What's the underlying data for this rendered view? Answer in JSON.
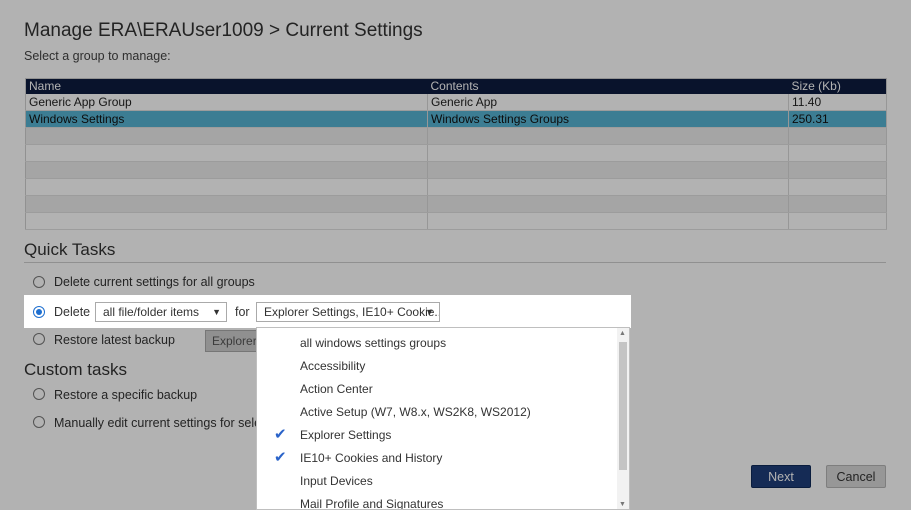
{
  "header": {
    "title": "Manage ERA\\ERAUser1009 > Current Settings",
    "subtitle": "Select a group to manage:"
  },
  "table": {
    "columns": [
      "Name",
      "Contents",
      "Size (Kb)"
    ],
    "rows": [
      {
        "name": "Generic App Group",
        "contents": "Generic App",
        "size": "11.40"
      },
      {
        "name": "Windows Settings",
        "contents": "Windows Settings Groups",
        "size": "250.31"
      }
    ]
  },
  "quick_tasks": {
    "heading": "Quick Tasks",
    "delete_all_label": "Delete current settings for all groups",
    "delete_label": "Delete",
    "items_select": "all file/folder items",
    "for_label": "for",
    "groups_select": "Explorer Settings, IE10+ Cookie...",
    "restore_latest_label": "Restore latest backup",
    "restore_select": "Explorer S"
  },
  "custom_tasks": {
    "heading": "Custom tasks",
    "restore_specific_label": "Restore a specific backup",
    "manual_edit_label": "Manually edit current settings for selecte"
  },
  "dropdown": {
    "items": [
      {
        "label": "all windows settings groups",
        "checked": false
      },
      {
        "label": "Accessibility",
        "checked": false
      },
      {
        "label": "Action Center",
        "checked": false
      },
      {
        "label": "Active Setup (W7, W8.x, WS2K8, WS2012)",
        "checked": false
      },
      {
        "label": "Explorer Settings",
        "checked": true
      },
      {
        "label": "IE10+ Cookies and History",
        "checked": true
      },
      {
        "label": "Input Devices",
        "checked": false
      },
      {
        "label": "Mail Profile and Signatures",
        "checked": false
      }
    ]
  },
  "buttons": {
    "next": "Next",
    "cancel": "Cancel"
  },
  "colors": {
    "header_bg": "#0e1c40",
    "selected_row": "#57b4d3",
    "primary_button": "#1f3e7a",
    "check": "#2a63c9"
  }
}
